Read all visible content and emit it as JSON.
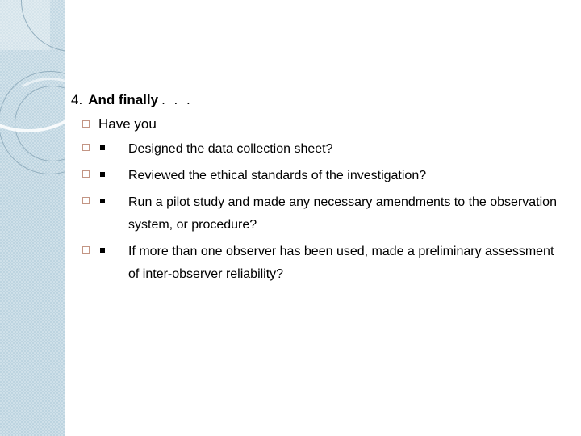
{
  "slide": {
    "heading": {
      "number": "4.",
      "text": "And finally",
      "dots": ". . ."
    },
    "lead_in": {
      "marker": "hollow-square-bullet",
      "text": "Have you"
    },
    "checklist": [
      {
        "marker": "hollow-square-bullet",
        "sub_marker": "filled-square-bullet",
        "text": "Designed the data collection sheet?"
      },
      {
        "marker": "hollow-square-bullet",
        "sub_marker": "filled-square-bullet",
        "text": "Reviewed the ethical standards of the investigation?"
      },
      {
        "marker": "hollow-square-bullet",
        "sub_marker": "filled-square-bullet",
        "text": "Run a pilot study and made any necessary amendments to the observation system, or procedure?"
      },
      {
        "marker": "hollow-square-bullet",
        "sub_marker": "filled-square-bullet",
        "text": "If more than one observer has been used, made a preliminary assessment of inter-observer reliability?"
      }
    ],
    "decoration": {
      "band_color": "#bdd4e0",
      "ring_color": "#93afbf",
      "arc_color": "#ffffff",
      "bullet_box_color": "#c39584",
      "background_color": "#ffffff",
      "text_color": "#000000"
    }
  }
}
